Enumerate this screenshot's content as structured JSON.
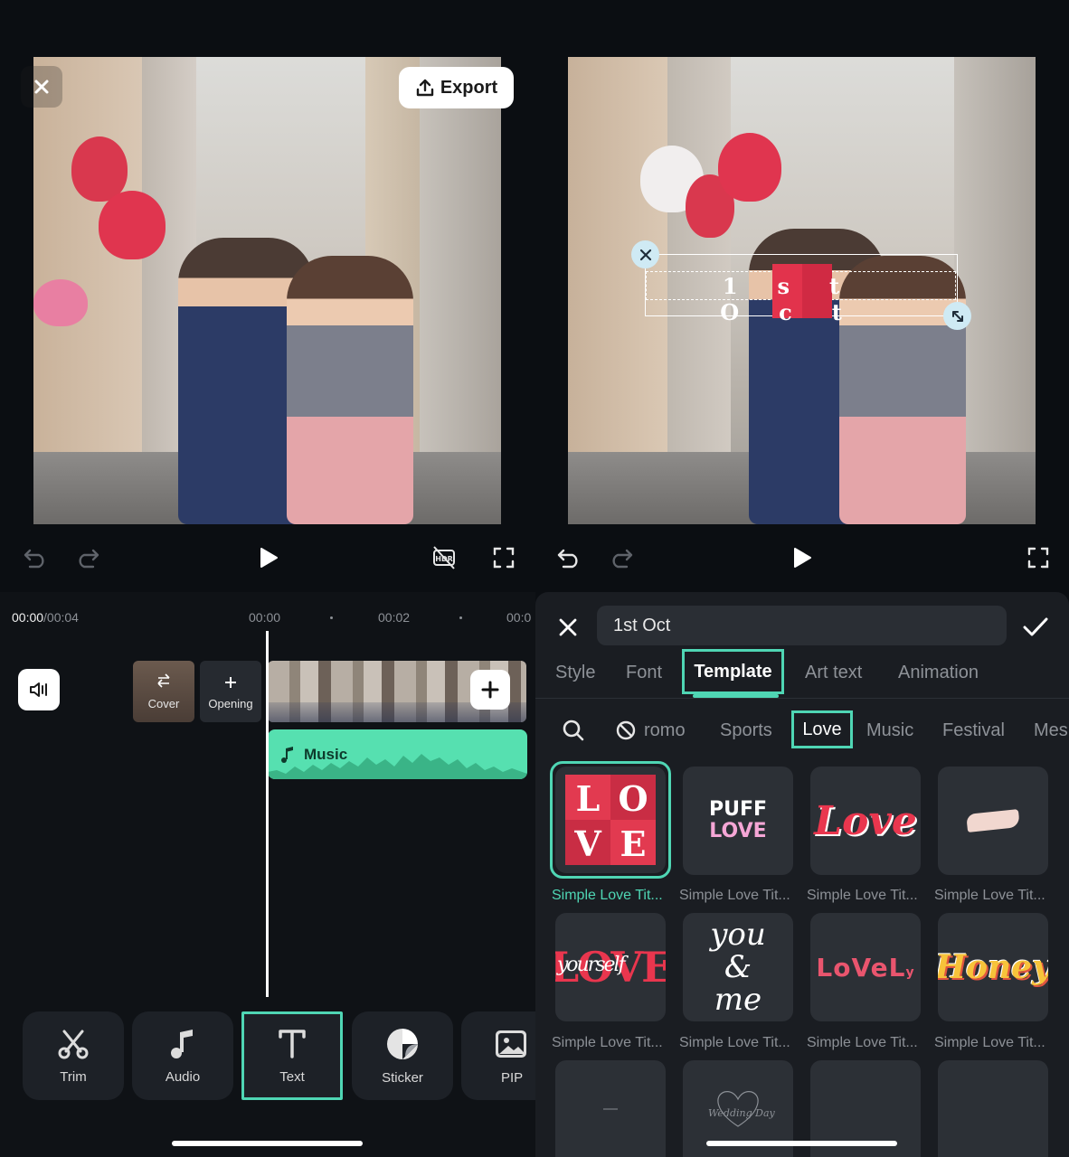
{
  "editor": {
    "export_label": "Export",
    "current_time": "00:00",
    "total_time": "/00:04",
    "ruler_marks": [
      "00:00",
      "00:02",
      "00:0"
    ]
  },
  "track": {
    "cover_label": "Cover",
    "opening_label": "Opening",
    "music_label": "Music"
  },
  "tools": [
    {
      "label": "Trim",
      "icon": "scissors-icon"
    },
    {
      "label": "Audio",
      "icon": "music-note-icon"
    },
    {
      "label": "Text",
      "icon": "text-icon",
      "selected": true
    },
    {
      "label": "Sticker",
      "icon": "sticker-icon"
    },
    {
      "label": "PIP",
      "icon": "pip-icon"
    }
  ],
  "overlay_text": "1st Oct",
  "text_panel": {
    "input_value": "1st Oct",
    "tabs": [
      "Style",
      "Font",
      "Template",
      "Art text",
      "Animation"
    ],
    "active_tab": "Template",
    "categories": [
      "romo",
      "Sports",
      "Love",
      "Music",
      "Festival",
      "Mes"
    ],
    "active_category": "Love",
    "templates": [
      {
        "caption": "Simple Love Tit...",
        "art": "L O V E",
        "selected": true
      },
      {
        "caption": "Simple Love Tit...",
        "art": "PUFF LOVE"
      },
      {
        "caption": "Simple Love Tit...",
        "art": "Love"
      },
      {
        "caption": "Simple Love Tit...",
        "art": ""
      },
      {
        "caption": "Simple Love Tit...",
        "art": "LOVE"
      },
      {
        "caption": "Simple Love Tit...",
        "art": "you & me"
      },
      {
        "caption": "Simple Love Tit...",
        "art": "LoVeL"
      },
      {
        "caption": "Simple Love Tit...",
        "art": "Honey"
      }
    ],
    "art_extras": {
      "yourself": "yourself",
      "wedding": "Wedding Day"
    }
  },
  "colors": {
    "accent": "#4fd6b4",
    "music_track": "#56e0b0",
    "panel_bg": "#1a1d22"
  }
}
